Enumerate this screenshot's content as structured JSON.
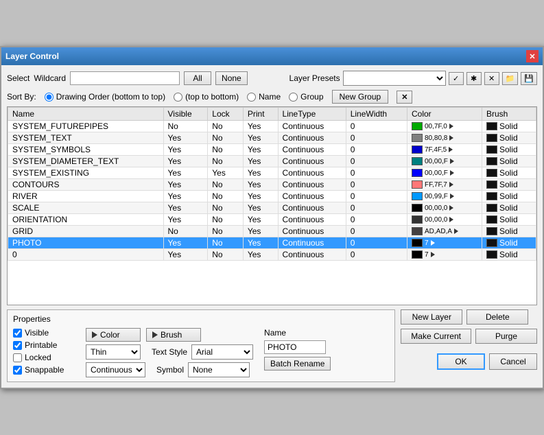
{
  "window": {
    "title": "Layer Control"
  },
  "select_area": {
    "label": "Select",
    "wildcard_label": "Wildcard",
    "wildcard_value": "",
    "all_btn": "All",
    "none_btn": "None"
  },
  "layer_presets": {
    "label": "Layer Presets",
    "value": ""
  },
  "sort": {
    "label": "Sort By:",
    "options": [
      "Drawing Order (bottom to top)",
      "(top to bottom)",
      "Name",
      "Group"
    ],
    "selected": "Drawing Order (bottom to top)",
    "new_group_btn": "New Group"
  },
  "table": {
    "headers": [
      "Name",
      "Visible",
      "Lock",
      "Print",
      "LineType",
      "LineWidth",
      "Color",
      "Brush"
    ],
    "rows": [
      {
        "name": "SYSTEM_FUTUREPIPES",
        "visible": "No",
        "lock": "No",
        "print": "Yes",
        "linetype": "Continuous",
        "linewidth": "0",
        "color_hex": "#00aa00",
        "color_label": "00,7F,0",
        "brush": "Solid"
      },
      {
        "name": "SYSTEM_TEXT",
        "visible": "Yes",
        "lock": "No",
        "print": "Yes",
        "linetype": "Continuous",
        "linewidth": "0",
        "color_hex": "#808080",
        "color_label": "80,80,8",
        "brush": "Solid"
      },
      {
        "name": "SYSTEM_SYMBOLS",
        "visible": "Yes",
        "lock": "No",
        "print": "Yes",
        "linetype": "Continuous",
        "linewidth": "0",
        "color_hex": "#0000cc",
        "color_label": "7F,4F,5",
        "brush": "Solid"
      },
      {
        "name": "SYSTEM_DIAMETER_TEXT",
        "visible": "Yes",
        "lock": "No",
        "print": "Yes",
        "linetype": "Continuous",
        "linewidth": "0",
        "color_hex": "#008080",
        "color_label": "00,00,F",
        "brush": "Solid"
      },
      {
        "name": "SYSTEM_EXISTING",
        "visible": "Yes",
        "lock": "Yes",
        "print": "Yes",
        "linetype": "Continuous",
        "linewidth": "0",
        "color_hex": "#0000ff",
        "color_label": "00,00,F",
        "brush": "Solid"
      },
      {
        "name": "CONTOURS",
        "visible": "Yes",
        "lock": "No",
        "print": "Yes",
        "linetype": "Continuous",
        "linewidth": "0",
        "color_hex": "#ff7777",
        "color_label": "FF,7F,7",
        "brush": "Solid"
      },
      {
        "name": "RIVER",
        "visible": "Yes",
        "lock": "No",
        "print": "Yes",
        "linetype": "Continuous",
        "linewidth": "0",
        "color_hex": "#0099ff",
        "color_label": "00,99,F",
        "brush": "Solid"
      },
      {
        "name": "SCALE",
        "visible": "Yes",
        "lock": "No",
        "print": "Yes",
        "linetype": "Continuous",
        "linewidth": "0",
        "color_hex": "#000000",
        "color_label": "00,00,0",
        "brush": "Solid"
      },
      {
        "name": "ORIENTATION",
        "visible": "Yes",
        "lock": "No",
        "print": "Yes",
        "linetype": "Continuous",
        "linewidth": "0",
        "color_hex": "#333333",
        "color_label": "00,00,0",
        "brush": "Solid"
      },
      {
        "name": "GRID",
        "visible": "No",
        "lock": "No",
        "print": "Yes",
        "linetype": "Continuous",
        "linewidth": "0",
        "color_hex": "#444040",
        "color_label": "AD,AD,A",
        "brush": "Solid"
      },
      {
        "name": "PHOTO",
        "visible": "Yes",
        "lock": "No",
        "print": "Yes",
        "linetype": "Continuous",
        "linewidth": "0",
        "color_hex": "#000000",
        "color_label": "7",
        "brush": "Solid",
        "selected": true
      },
      {
        "name": "0",
        "visible": "Yes",
        "lock": "No",
        "print": "Yes",
        "linetype": "Continuous",
        "linewidth": "0",
        "color_hex": "#000000",
        "color_label": "7",
        "brush": "Solid"
      }
    ]
  },
  "properties": {
    "label": "Properties",
    "visible_label": "Visible",
    "printable_label": "Printable",
    "locked_label": "Locked",
    "snappable_label": "Snappable",
    "color_btn": "Color",
    "brush_btn": "Brush",
    "line_width_label": "Thin",
    "line_type_label": "Continuous",
    "text_style_label": "Text Style",
    "text_style_value": "Arial",
    "symbol_label": "Symbol",
    "symbol_value": "None",
    "name_label": "Name",
    "name_value": "PHOTO",
    "batch_rename_btn": "Batch Rename"
  },
  "buttons": {
    "new_layer": "New Layer",
    "delete": "Delete",
    "make_current": "Make Current",
    "purge": "Purge",
    "ok": "OK",
    "cancel": "Cancel"
  }
}
